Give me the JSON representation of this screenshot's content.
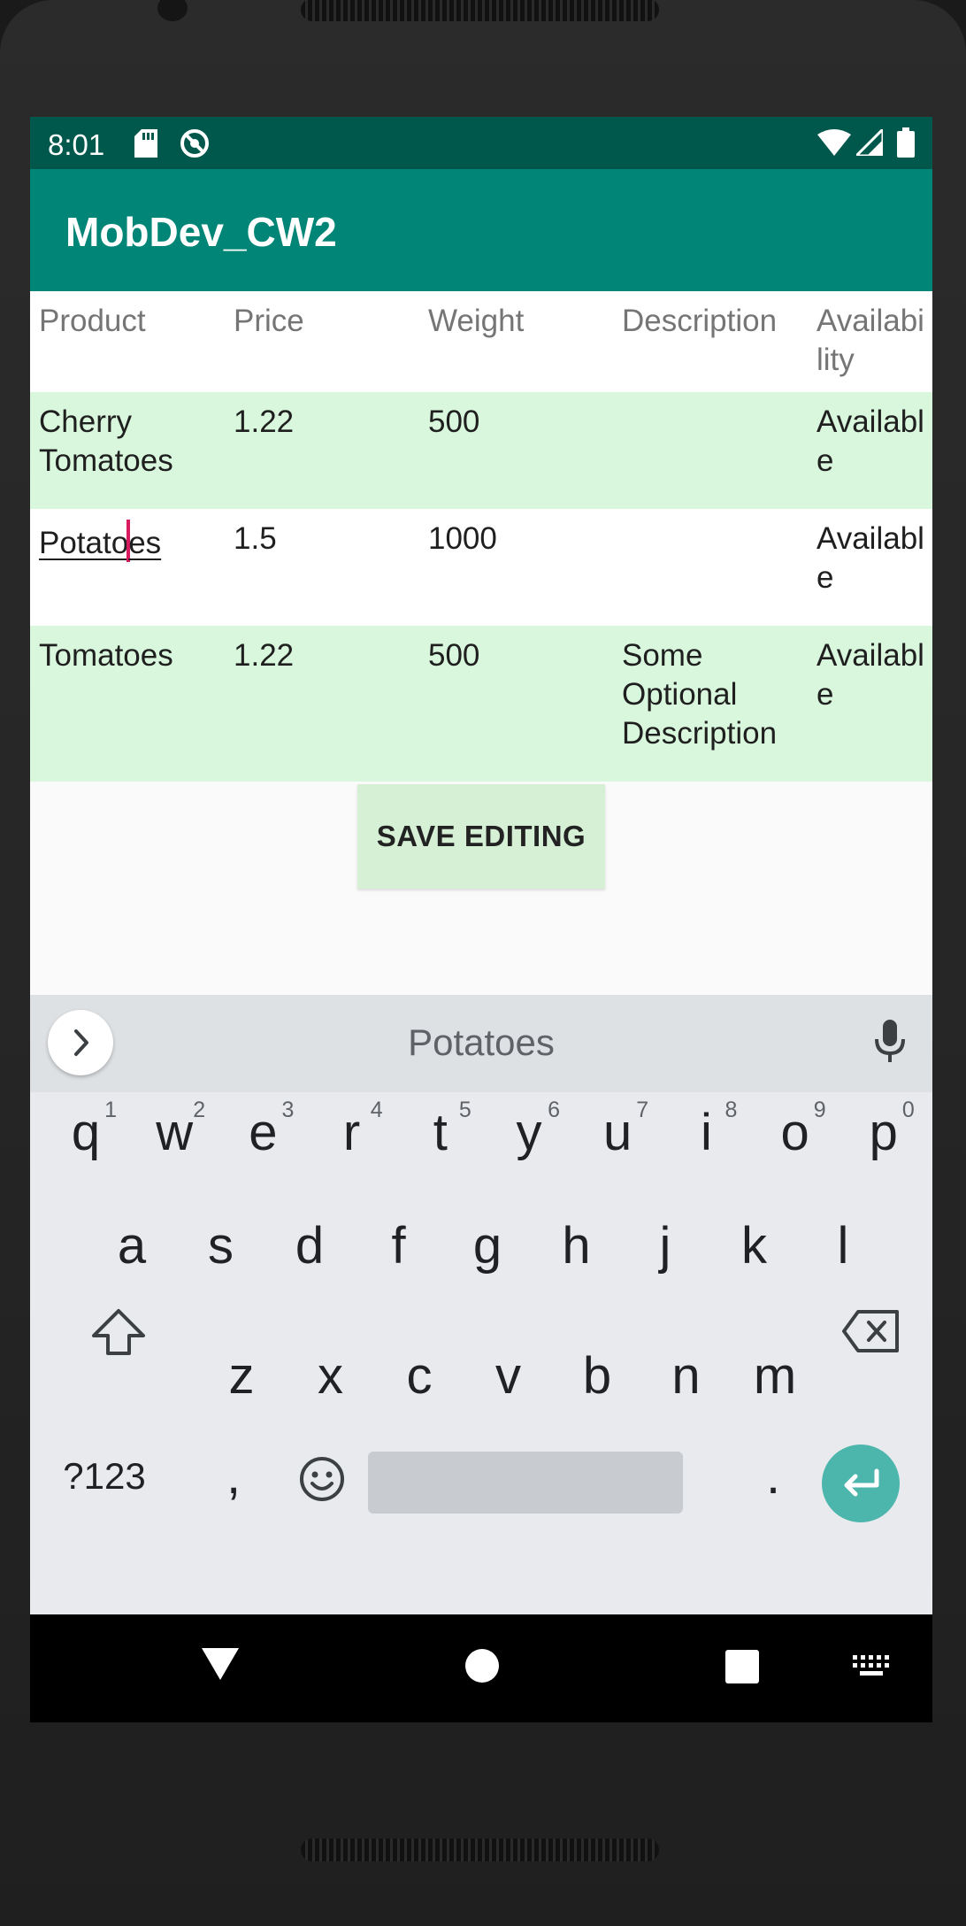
{
  "status_bar": {
    "time": "8:01",
    "icons": [
      "sd-card-icon",
      "sync-off-icon",
      "wifi-icon",
      "signal-icon",
      "battery-icon"
    ]
  },
  "app": {
    "title": "MobDev_CW2"
  },
  "table": {
    "headers": [
      "Product",
      "Price",
      "Weight",
      "Description",
      "Availability"
    ],
    "rows": [
      {
        "product": "Cherry Tomatoes",
        "price": "1.22",
        "weight": "500",
        "description": "",
        "availability": "Available"
      },
      {
        "product": "Potatoes",
        "product_before_caret": "Potato",
        "product_after_caret": "es",
        "price": "1.5",
        "weight": "1000",
        "description": "",
        "availability": "Available"
      },
      {
        "product": "Tomatoes",
        "price": "1.22",
        "weight": "500",
        "description": "Some Optional Description",
        "availability": "Available"
      }
    ]
  },
  "save_button": {
    "label": "SAVE EDITING"
  },
  "keyboard": {
    "suggestion": "Potatoes",
    "row1": [
      "q",
      "w",
      "e",
      "r",
      "t",
      "y",
      "u",
      "i",
      "o",
      "p"
    ],
    "row1_hints": [
      "1",
      "2",
      "3",
      "4",
      "5",
      "6",
      "7",
      "8",
      "9",
      "0"
    ],
    "row2": [
      "a",
      "s",
      "d",
      "f",
      "g",
      "h",
      "j",
      "k",
      "l"
    ],
    "row3": [
      "z",
      "x",
      "c",
      "v",
      "b",
      "n",
      "m"
    ],
    "symbols_label": "?123",
    "comma": ",",
    "period": "."
  },
  "colors": {
    "status_bar": "#00574b",
    "app_bar": "#008577",
    "row_highlight": "#d8f7dc",
    "accent": "#4db6ac",
    "caret": "#d81b60"
  }
}
